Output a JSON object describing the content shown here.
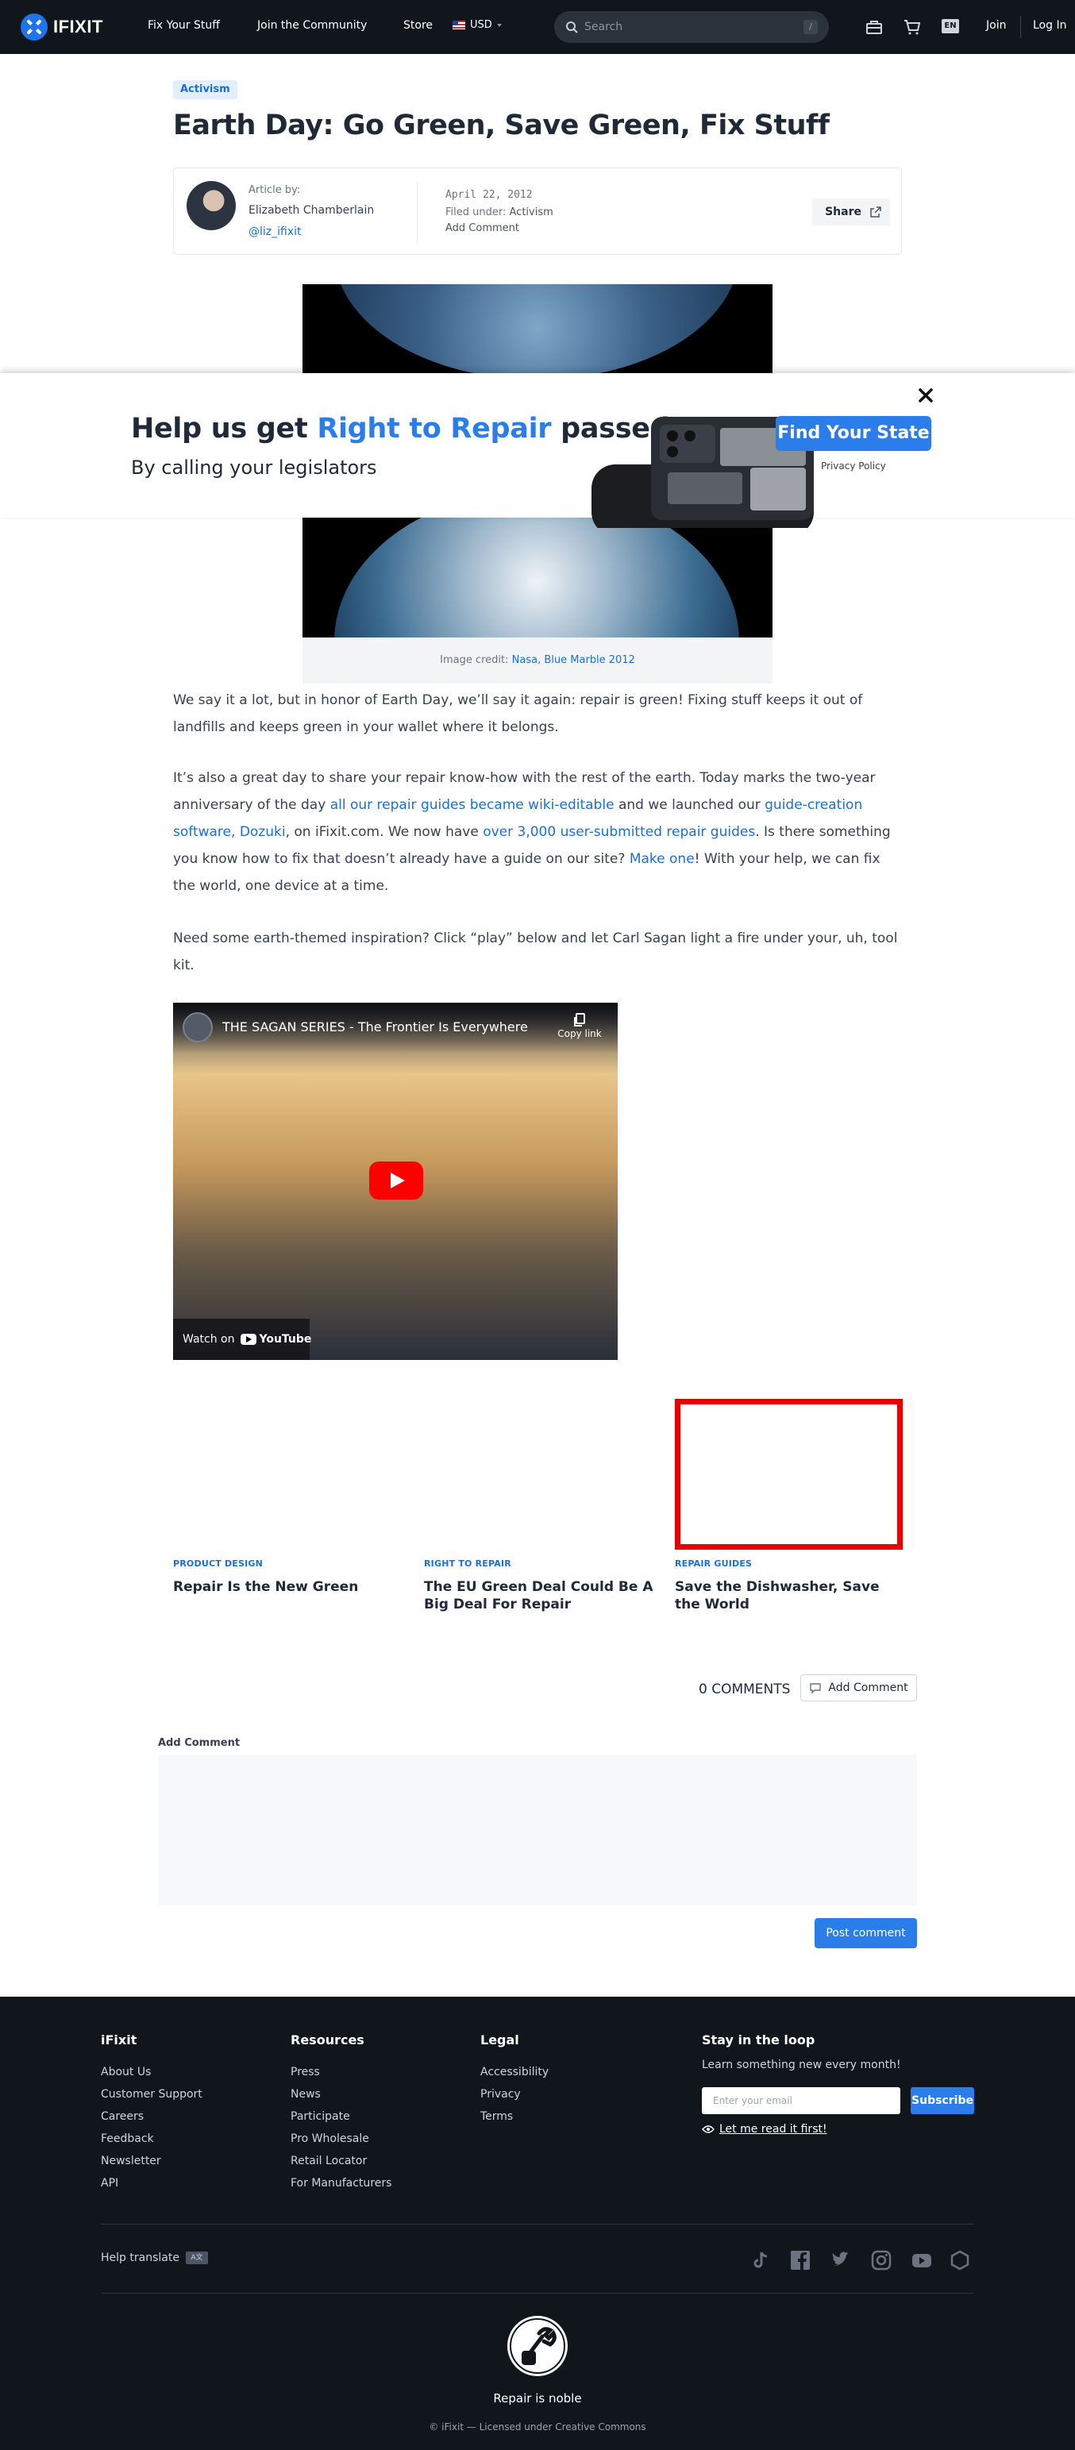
{
  "nav": {
    "brand": "IFIXIT",
    "links": [
      "Fix Your Stuff",
      "Join the Community",
      "Store"
    ],
    "currency": "USD",
    "search_placeholder": "Search",
    "search_shortcut": "/",
    "language": "EN",
    "join": "Join",
    "login": "Log In"
  },
  "article": {
    "tag": "Activism",
    "title": "Earth Day: Go Green, Save Green, Fix Stuff",
    "byline_label": "Article by:",
    "author": "Elizabeth Chamberlain",
    "handle": "@liz_ifixit",
    "date": "April 22, 2012",
    "filed_label": "Filed under:",
    "filed_value": "Activism",
    "add_comment": "Add Comment",
    "share": "Share"
  },
  "hero": {
    "caption_prefix": "Image credit:",
    "caption_link": "Nasa, Blue Marble 2012"
  },
  "banner": {
    "title_pre": "Help us get",
    "title_hl": "Right to Repair",
    "title_post": "passed",
    "subtitle": "By calling your legislators",
    "cta": "Find Your State",
    "privacy": "Privacy Policy"
  },
  "body": {
    "p1": "We say it a lot, but in honor of Earth Day, we’ll say it again: repair is green! Fixing stuff keeps it out of landfills and keeps green in your wallet where it belongs.",
    "p2": {
      "t1": "It’s also a great day to share your repair know-how with the rest of the earth. Today marks the two-year anniversary of the day ",
      "l1": "all our repair guides became wiki-editable",
      "t2": " and we launched our ",
      "l2": "guide-creation software, Dozuki",
      "t3": ", on iFixit.com. We now have ",
      "l3": "over 3,000 user-submitted repair guides",
      "t4": ". Is there something you know how to fix that doesn’t already have a guide on our site? ",
      "l4": "Make one",
      "t5": "! With your help, we can fix the world, one device at a time."
    },
    "p3": "Need some earth-themed inspiration? Click “play” below and let Carl Sagan light a fire under your, uh, tool kit."
  },
  "video": {
    "title": "THE SAGAN SERIES - The Frontier Is Everywhere",
    "copy_link": "Copy link",
    "watch_on": "Watch on",
    "youtube": "YouTube"
  },
  "related": [
    {
      "category": "PRODUCT DESIGN",
      "title": "Repair Is the New Green"
    },
    {
      "category": "RIGHT TO REPAIR",
      "title": "The EU Green Deal Could Be A Big Deal For Repair"
    },
    {
      "category": "REPAIR GUIDES",
      "title": "Save the Dishwasher, Save the World"
    }
  ],
  "comments": {
    "count": "0 COMMENTS",
    "add_button": "Add Comment",
    "form_label": "Add Comment",
    "post": "Post comment"
  },
  "footer": {
    "col1": {
      "head": "iFixit",
      "links": [
        "About Us",
        "Customer Support",
        "Careers",
        "Feedback",
        "Newsletter",
        "API"
      ]
    },
    "col2": {
      "head": "Resources",
      "links": [
        "Press",
        "News",
        "Participate",
        "Pro Wholesale",
        "Retail Locator",
        "For Manufacturers"
      ]
    },
    "col3": {
      "head": "Legal",
      "links": [
        "Accessibility",
        "Privacy",
        "Terms"
      ]
    },
    "newsletter": {
      "head": "Stay in the loop",
      "sub": "Learn something new every month!",
      "placeholder": "Enter your email",
      "subscribe": "Subscribe",
      "read_first": "Let me read it first!"
    },
    "translate": "Help translate",
    "translate_icon": "A文",
    "social_icons": [
      "tiktok-icon",
      "facebook-icon",
      "twitter-icon",
      "instagram-icon",
      "youtube-icon",
      "hexagon-icon"
    ],
    "tagline": "Repair is noble",
    "copyright": "© iFixit — Licensed under Creative Commons"
  },
  "colors": {
    "accent": "#2b7de9",
    "nav_bg": "#11161d",
    "link": "#1a6fd8",
    "highlight_box": "#e60000"
  }
}
